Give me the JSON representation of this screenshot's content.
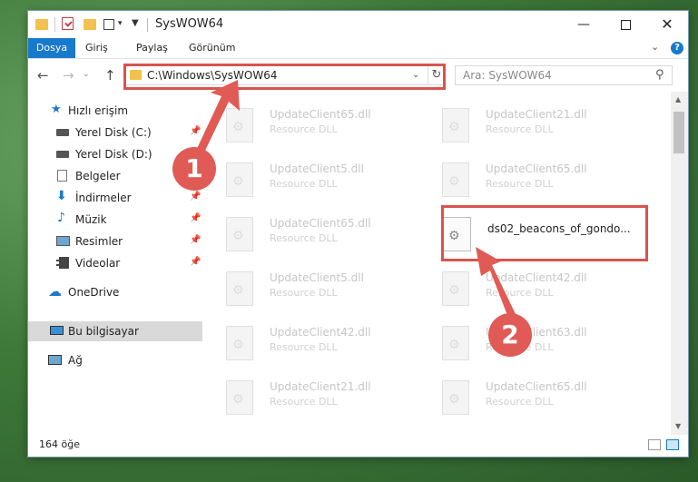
{
  "window": {
    "title": "SysWOW64"
  },
  "ribbon": {
    "tabs": [
      "Dosya",
      "Giriş",
      "Paylaş",
      "Görünüm"
    ],
    "help": "?"
  },
  "nav": {
    "address": "C:\\Windows\\SysWOW64",
    "search_placeholder": "Ara: SysWOW64"
  },
  "sidebar": {
    "items": [
      {
        "label": "Hızlı erişim",
        "icon": "star-icon"
      },
      {
        "label": "Yerel Disk (C:)",
        "icon": "drive-icon",
        "pinned": true
      },
      {
        "label": "Yerel Disk (D:)",
        "icon": "drive-icon"
      },
      {
        "label": "Belgeler",
        "icon": "documents-icon"
      },
      {
        "label": "İndirmeler",
        "icon": "download-icon",
        "pinned": true
      },
      {
        "label": "Müzik",
        "icon": "music-icon",
        "pinned": true
      },
      {
        "label": "Resimler",
        "icon": "pictures-icon",
        "pinned": true
      },
      {
        "label": "Videolar",
        "icon": "videos-icon",
        "pinned": true
      },
      {
        "label": "OneDrive",
        "icon": "cloud-icon"
      },
      {
        "label": "Bu bilgisayar",
        "icon": "computer-icon",
        "selected": true
      },
      {
        "label": "Ağ",
        "icon": "network-icon"
      }
    ]
  },
  "files": [
    {
      "name": "UpdateClient65.dll",
      "type": "Resource DLL"
    },
    {
      "name": "UpdateClient21.dll",
      "type": "Resource DLL"
    },
    {
      "name": "UpdateClient5.dll",
      "type": "Resource DLL"
    },
    {
      "name": "UpdateClient65.dll",
      "type": "Resource DLL"
    },
    {
      "name": "UpdateClient65.dll",
      "type": "Resource DLL"
    },
    {
      "name": "ds02_beacons_of_gondo...",
      "type": ""
    },
    {
      "name": "UpdateClient5.dll",
      "type": "Resource DLL"
    },
    {
      "name": "UpdateClient42.dll",
      "type": "Resource DLL"
    },
    {
      "name": "UpdateClient42.dll",
      "type": "Resource DLL"
    },
    {
      "name": "UpdateClient63.dll",
      "type": "Resource DLL"
    },
    {
      "name": "UpdateClient21.dll",
      "type": "Resource DLL"
    },
    {
      "name": "UpdateClient65.dll",
      "type": "Resource DLL"
    }
  ],
  "status": {
    "count": "164 öğe"
  },
  "annotations": {
    "badge1": "1",
    "badge2": "2",
    "color": "#d9534f"
  }
}
